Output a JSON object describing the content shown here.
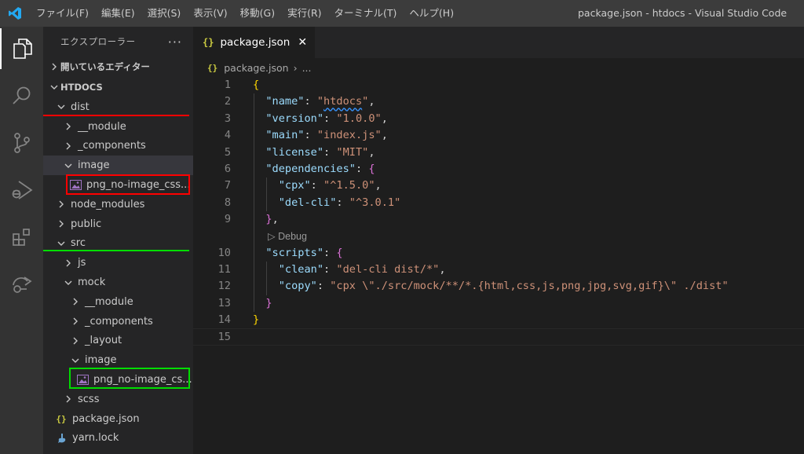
{
  "titlebar": {
    "menu": [
      "ファイル(F)",
      "編集(E)",
      "選択(S)",
      "表示(V)",
      "移動(G)",
      "実行(R)",
      "ターミナル(T)",
      "ヘルプ(H)"
    ],
    "window_title": "package.json - htdocs - Visual Studio Code"
  },
  "activity": [
    "explorer-icon",
    "search-icon",
    "source-control-icon",
    "run-debug-icon",
    "extensions-icon",
    "remote-icon"
  ],
  "sidebar": {
    "header": "エクスプローラー",
    "more": "···",
    "open_editors": "開いているエディター",
    "project": "HTDOCS",
    "tree": [
      {
        "label": "dist",
        "depth": 1,
        "chevron": "down"
      },
      {
        "label": "__module",
        "depth": 2,
        "chevron": "right"
      },
      {
        "label": "_components",
        "depth": 2,
        "chevron": "right"
      },
      {
        "label": "image",
        "depth": 2,
        "chevron": "down"
      },
      {
        "label": "png_no-image_css...",
        "depth": 3,
        "chevron": "none",
        "file": "image"
      },
      {
        "label": "node_modules",
        "depth": 1,
        "chevron": "right"
      },
      {
        "label": "public",
        "depth": 1,
        "chevron": "right"
      },
      {
        "label": "src",
        "depth": 1,
        "chevron": "down"
      },
      {
        "label": "js",
        "depth": 2,
        "chevron": "right"
      },
      {
        "label": "mock",
        "depth": 2,
        "chevron": "down"
      },
      {
        "label": "__module",
        "depth": 3,
        "chevron": "right"
      },
      {
        "label": "_components",
        "depth": 3,
        "chevron": "right"
      },
      {
        "label": "_layout",
        "depth": 3,
        "chevron": "right"
      },
      {
        "label": "image",
        "depth": 3,
        "chevron": "down"
      },
      {
        "label": "png_no-image_cs...",
        "depth": 4,
        "chevron": "none",
        "file": "image"
      },
      {
        "label": "scss",
        "depth": 2,
        "chevron": "right"
      },
      {
        "label": "package.json",
        "depth": 1,
        "chevron": "none",
        "file": "json"
      },
      {
        "label": "yarn.lock",
        "depth": 1,
        "chevron": "none",
        "file": "yarn"
      }
    ]
  },
  "editor": {
    "tab_icon": "{}",
    "tab_label": "package.json",
    "tab_close": "✕",
    "breadcrumb_icon": "{}",
    "breadcrumb_file": "package.json",
    "breadcrumb_sep": "›",
    "breadcrumb_more": "...",
    "codelens": "▷ Debug",
    "lines": [
      {
        "n": "1",
        "html": "<span class='b1'>{</span>"
      },
      {
        "n": "2",
        "html": "  <span class='k'>\"name\"</span><span class='p'>: </span><span class='s'>\"<span class='squig'>htdocs</span>\"</span><span class='p'>,</span>"
      },
      {
        "n": "3",
        "html": "  <span class='k'>\"version\"</span><span class='p'>: </span><span class='s'>\"1.0.0\"</span><span class='p'>,</span>"
      },
      {
        "n": "4",
        "html": "  <span class='k'>\"main\"</span><span class='p'>: </span><span class='s'>\"index.js\"</span><span class='p'>,</span>"
      },
      {
        "n": "5",
        "html": "  <span class='k'>\"license\"</span><span class='p'>: </span><span class='s'>\"MIT\"</span><span class='p'>,</span>"
      },
      {
        "n": "6",
        "html": "  <span class='k'>\"dependencies\"</span><span class='p'>: </span><span class='b2'>{</span>"
      },
      {
        "n": "7",
        "html": "    <span class='k'>\"cpx\"</span><span class='p'>: </span><span class='s'>\"^1.5.0\"</span><span class='p'>,</span>"
      },
      {
        "n": "8",
        "html": "    <span class='k'>\"del-cli\"</span><span class='p'>: </span><span class='s'>\"^3.0.1\"</span>"
      },
      {
        "n": "9",
        "html": "  <span class='b2'>}</span><span class='p'>,</span>",
        "lens_after": true
      },
      {
        "n": "10",
        "html": "  <span class='k'>\"scripts\"</span><span class='p'>: </span><span class='b2'>{</span>"
      },
      {
        "n": "11",
        "html": "    <span class='k'>\"clean\"</span><span class='p'>: </span><span class='s'>\"del-cli dist/*\"</span><span class='p'>,</span>"
      },
      {
        "n": "12",
        "html": "    <span class='k'>\"copy\"</span><span class='p'>: </span><span class='s'>\"cpx \\\"./src/mock/**/*.{html,css,js,png,jpg,svg,gif}\\\" ./dist\"</span>"
      },
      {
        "n": "13",
        "html": "  <span class='b2'>}</span>"
      },
      {
        "n": "14",
        "html": "<span class='b1'>}</span>"
      },
      {
        "n": "15",
        "html": "",
        "current": true
      }
    ]
  },
  "colors": {
    "titlebar": "#3c3c3c",
    "activitybar": "#333333",
    "sidebar": "#252526",
    "editor": "#1e1e1e",
    "annotation_red": "#ff0000",
    "annotation_green": "#00dd00"
  }
}
